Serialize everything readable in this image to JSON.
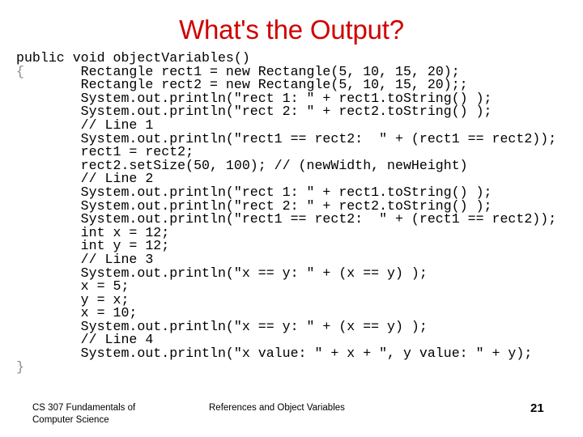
{
  "slide": {
    "title": "What's the Output?",
    "title_color": "#D00000",
    "background_color": "#FFFFFF",
    "text_color": "#000000",
    "brace_color": "#8A8A8A"
  },
  "code": {
    "language": "java",
    "lines": [
      "public void objectVariables()",
      "{       Rectangle rect1 = new Rectangle(5, 10, 15, 20);",
      "        Rectangle rect2 = new Rectangle(5, 10, 15, 20);;",
      "        System.out.println(\"rect 1: \" + rect1.toString() );",
      "        System.out.println(\"rect 2: \" + rect2.toString() );",
      "        // Line 1",
      "        System.out.println(\"rect1 == rect2:  \" + (rect1 == rect2));",
      "        rect1 = rect2;",
      "        rect2.setSize(50, 100); // (newWidth, newHeight)",
      "        // Line 2",
      "        System.out.println(\"rect 1: \" + rect1.toString() );",
      "        System.out.println(\"rect 2: \" + rect2.toString() );",
      "        System.out.println(\"rect1 == rect2:  \" + (rect1 == rect2));",
      "        int x = 12;",
      "        int y = 12;",
      "        // Line 3",
      "        System.out.println(\"x == y: \" + (x == y) );",
      "        x = 5;",
      "        y = x;",
      "        x = 10;",
      "        System.out.println(\"x == y: \" + (x == y) );",
      "        // Line 4",
      "        System.out.println(\"x value: \" + x + \", y value: \" + y);",
      "}"
    ]
  },
  "footer": {
    "left_line1": "CS 307 Fundamentals of",
    "left_line2": "Computer Science",
    "center": "References and Object Variables",
    "page_number": "21"
  }
}
